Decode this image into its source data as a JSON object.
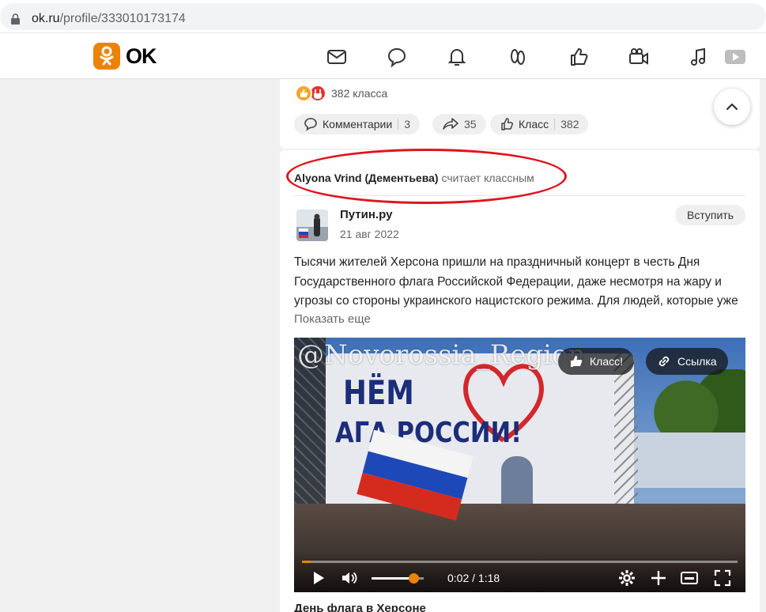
{
  "browser": {
    "url_host": "ok.ru",
    "url_path": "/profile/333010173174"
  },
  "header": {
    "logo_text": "OK",
    "nav_icons": [
      "mail-icon",
      "chat-icon",
      "bell-icon",
      "guests-icon",
      "like-icon",
      "video-icon",
      "music-icon",
      "play-icon"
    ]
  },
  "previous_post": {
    "reactions_count": "382 класса",
    "comments_label": "Комментарии",
    "comments_count": "3",
    "shares_count": "35",
    "likes_label": "Класс",
    "likes_count": "382"
  },
  "post": {
    "liked_by_name": "Alyona Vrind (Дементьева)",
    "liked_by_suffix": " считает классным",
    "group_name": "Путин.ру",
    "date": "21 авг 2022",
    "join_label": "Вступить",
    "text": "Тысячи жителей Херсона пришли на праздничный концерт в честь Дня Государственного флага Российской Федерации, даже несмотря на жару и угрозы со стороны украинского нацистского режима. Для людей, которые уже",
    "show_more": "Показать еще",
    "caption": "День флага в Херсоне"
  },
  "video": {
    "watermark": "@Novorossia_Region",
    "banner_line1": "НЁМ",
    "banner_line2": "АГА РОССИИ!",
    "class_label": "Класс!",
    "link_label": "Ссылка",
    "time": "0:02 / 1:18",
    "progress": 0.02,
    "volume": 0.8
  },
  "colors": {
    "accent": "#ee8208",
    "annotation": "#e0141e"
  }
}
